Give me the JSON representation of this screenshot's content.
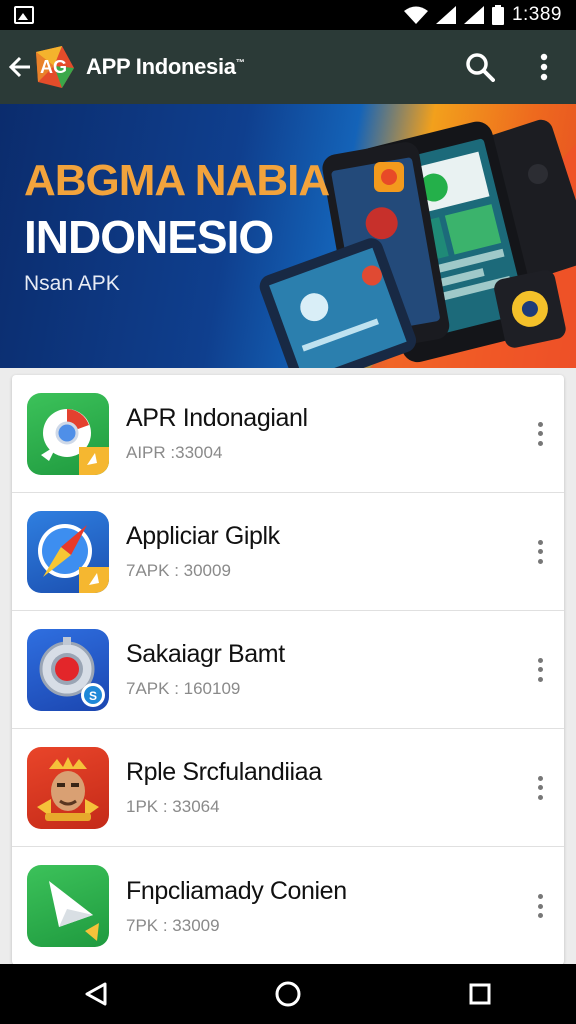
{
  "status_bar": {
    "time": "1:389"
  },
  "app_bar": {
    "title": "APP Indonesia",
    "trademark": "™",
    "logo_text": "AG"
  },
  "banner": {
    "headline1": "ABGMA NABIA",
    "headline2": "INDONESIO",
    "subtitle": "Nsan APK"
  },
  "apps": [
    {
      "name": "APR Indonagianl",
      "meta": "AIPR :33004"
    },
    {
      "name": "Appliciar Giplk",
      "meta": "7APK : 30009"
    },
    {
      "name": "Sakaiagr Bamt",
      "meta": "7APK : 160109"
    },
    {
      "name": "Rple Srcfulandiiaa",
      "meta": "1PK : 33064"
    },
    {
      "name": "Fnpcliamady Conien",
      "meta": "7PK : 33009"
    }
  ],
  "colors": {
    "app_bar": "#2b3a37",
    "headline_accent": "#f2a33c",
    "banner_blue": "#0f3f8e",
    "banner_orange": "#ee6a1e"
  }
}
